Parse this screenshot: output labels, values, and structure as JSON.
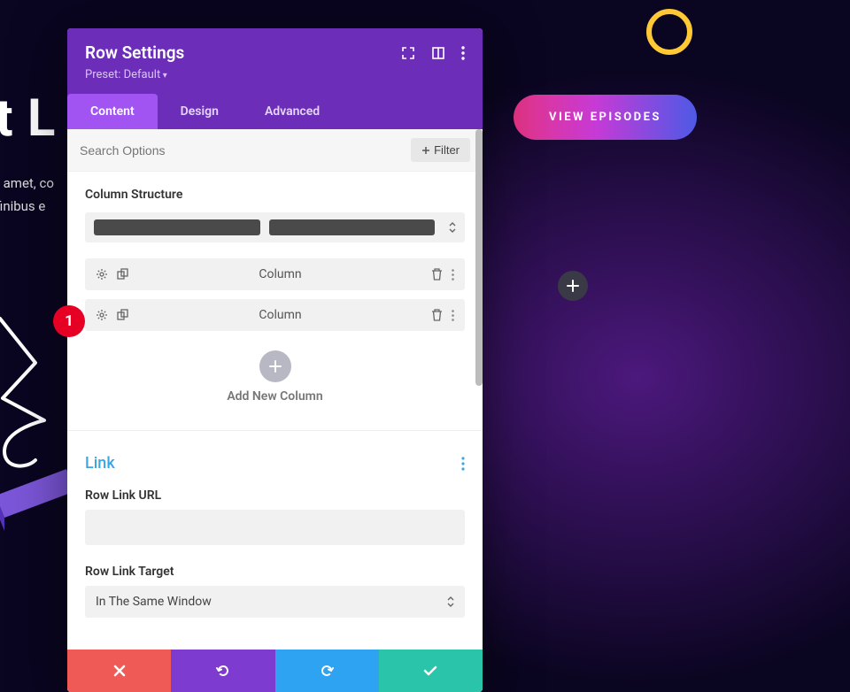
{
  "background": {
    "big_text": "t L",
    "small_line1": "t amet, co",
    "small_line2": "finibus e",
    "cta": "VIEW EPISODES"
  },
  "modal": {
    "title": "Row Settings",
    "preset": "Preset: Default",
    "tabs": {
      "content": "Content",
      "design": "Design",
      "advanced": "Advanced"
    },
    "search_placeholder": "Search Options",
    "filter_label": "Filter",
    "column_structure_label": "Column Structure",
    "columns": [
      {
        "label": "Column"
      },
      {
        "label": "Column"
      }
    ],
    "add_new_column": "Add New Column",
    "link": {
      "title": "Link",
      "url_label": "Row Link URL",
      "url_value": "",
      "target_label": "Row Link Target",
      "target_value": "In The Same Window"
    }
  },
  "annotation": {
    "badge": "1"
  }
}
